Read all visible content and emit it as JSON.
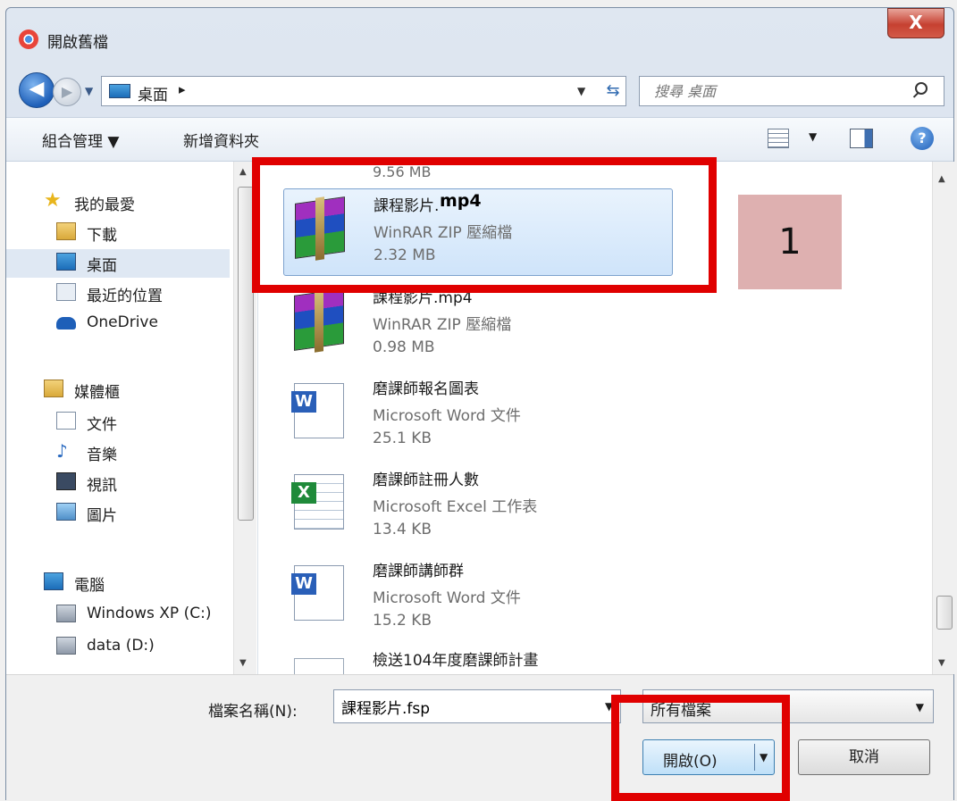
{
  "window": {
    "title": "開啟舊檔",
    "close_label": "X"
  },
  "nav": {
    "back_glyph": "◀",
    "forward_glyph": "▶",
    "address": "桌面",
    "address_arrow": "▸",
    "search_placeholder": "搜尋 桌面"
  },
  "toolbar": {
    "organize": "組合管理 ▼",
    "new_folder": "新增資料夾",
    "help": "?"
  },
  "sidebar": {
    "items": [
      {
        "label": "我的最愛",
        "icon": "star-icon"
      },
      {
        "label": "下載",
        "icon": "download-folder-icon"
      },
      {
        "label": "桌面",
        "icon": "desktop-icon"
      },
      {
        "label": "最近的位置",
        "icon": "recent-places-icon"
      },
      {
        "label": "OneDrive",
        "icon": "onedrive-icon"
      },
      {
        "label": "媒體櫃",
        "icon": "library-icon"
      },
      {
        "label": "文件",
        "icon": "documents-icon"
      },
      {
        "label": "音樂",
        "icon": "music-icon"
      },
      {
        "label": "視訊",
        "icon": "video-icon"
      },
      {
        "label": "圖片",
        "icon": "pictures-icon"
      },
      {
        "label": "電腦",
        "icon": "computer-icon"
      },
      {
        "label": "Windows XP (C:)",
        "icon": "drive-icon"
      },
      {
        "label": "data (D:)",
        "icon": "drive-icon"
      }
    ]
  },
  "files": [
    {
      "name": "課程影片.",
      "type": "WinRAR ZIP 壓縮檔",
      "size": "2.32 MB",
      "icon": "winrar-icon",
      "selected": true,
      "name_suffix": "mp4"
    },
    {
      "name": "課程影片.mp4",
      "type": "WinRAR ZIP 壓縮檔",
      "size": "0.98 MB",
      "icon": "winrar-icon"
    },
    {
      "name": "磨課師報名圖表",
      "type": "Microsoft Word 文件",
      "size": "25.1 KB",
      "icon": "word-doc-icon"
    },
    {
      "name": "磨課師註冊人數",
      "type": "Microsoft Excel 工作表",
      "size": "13.4 KB",
      "icon": "excel-sheet-icon"
    },
    {
      "name": "磨課師講師群",
      "type": "Microsoft Word 文件",
      "size": "15.2 KB",
      "icon": "word-doc-icon"
    },
    {
      "name": "檢送104年度磨課師計畫",
      "icon": "document-icon"
    }
  ],
  "partial_top_size": "9.56 MB",
  "bottom": {
    "filename_label": "檔案名稱(N):",
    "filename_value": "課程影片.fsp",
    "filetype_value": "所有檔案",
    "open_label": "開啟(O)",
    "cancel_label": "取消"
  },
  "annotation": {
    "callout_number": "1",
    "highlight_color": "#e00000"
  }
}
